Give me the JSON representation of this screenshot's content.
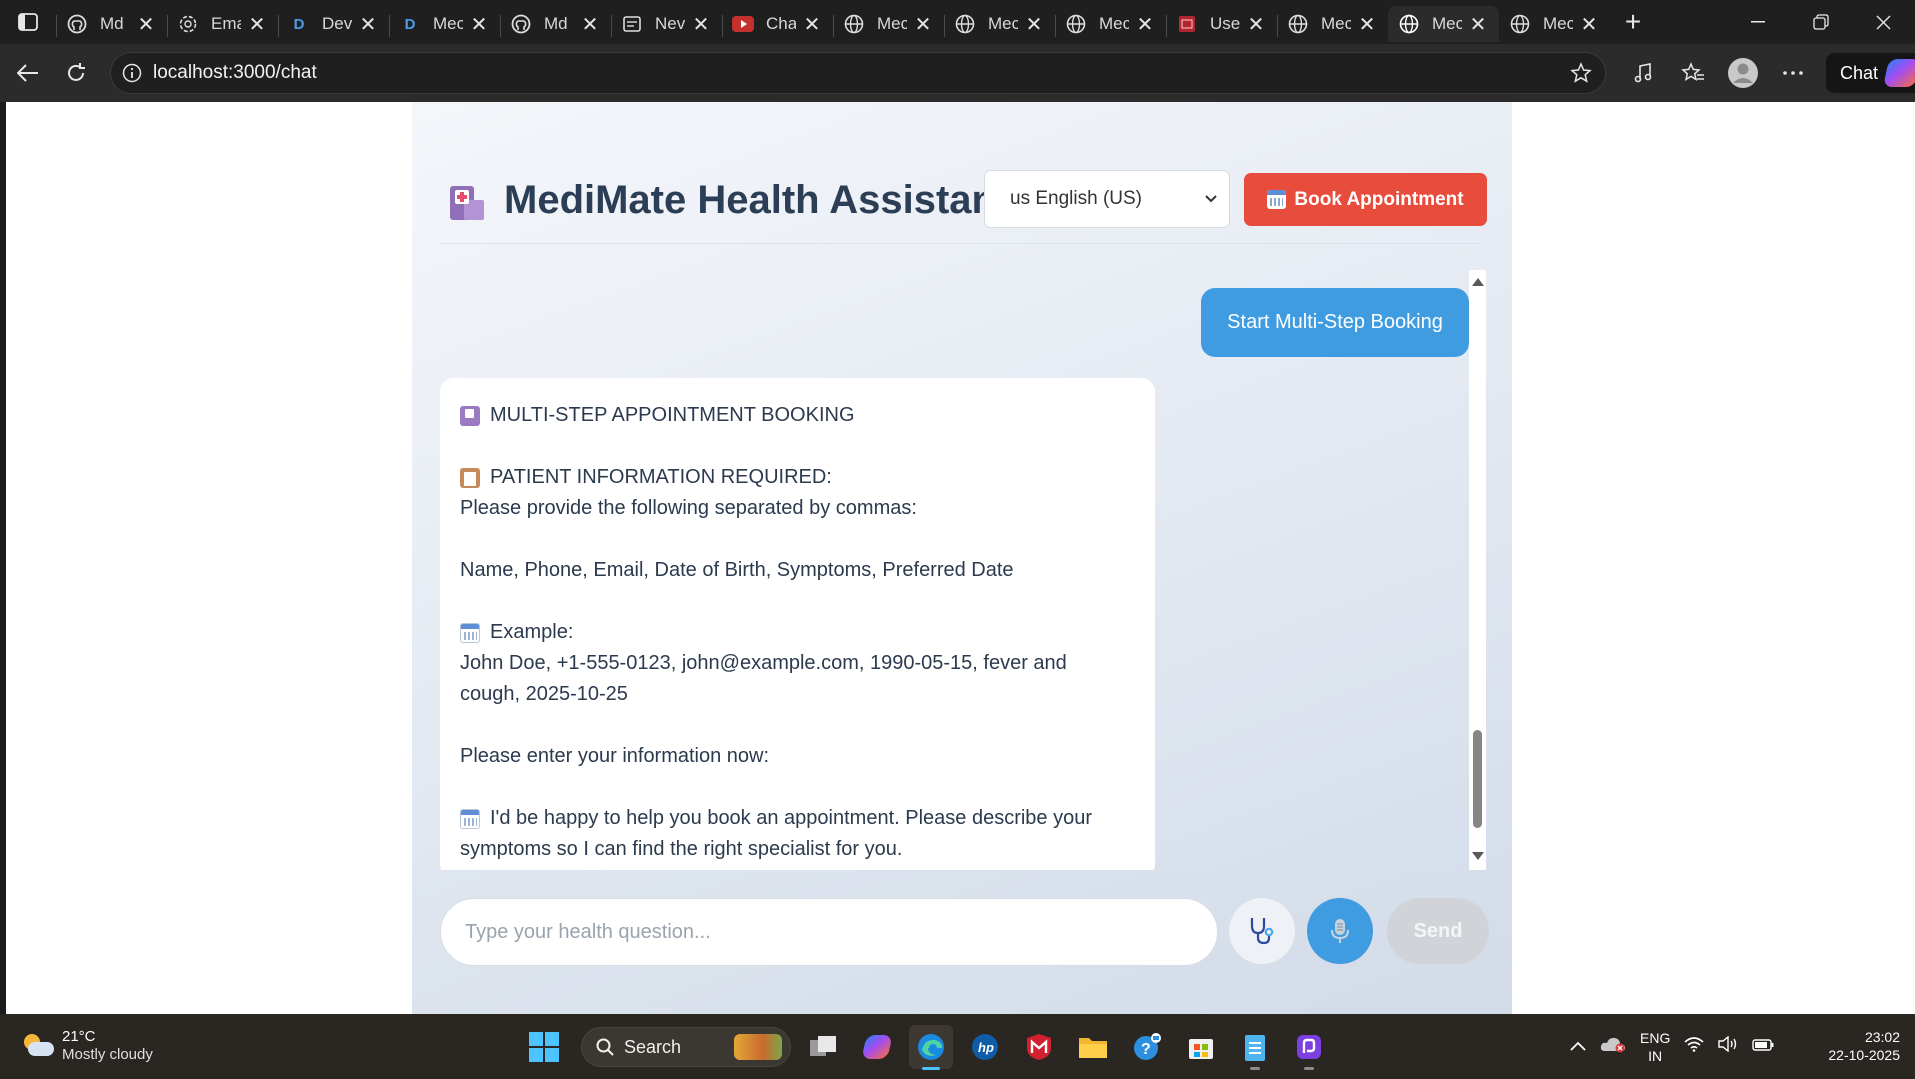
{
  "browser": {
    "tabs": [
      {
        "title": "Md",
        "icon": "github-icon"
      },
      {
        "title": "Ema",
        "icon": "openai-icon"
      },
      {
        "title": "Dev",
        "icon": "d-icon"
      },
      {
        "title": "Mec",
        "icon": "d-icon"
      },
      {
        "title": "Md",
        "icon": "github-icon"
      },
      {
        "title": "Nev",
        "icon": "page-icon"
      },
      {
        "title": "Cha",
        "icon": "youtube-icon"
      },
      {
        "title": "Mec",
        "icon": "globe-icon"
      },
      {
        "title": "Mec",
        "icon": "globe-icon"
      },
      {
        "title": "Mec",
        "icon": "globe-icon"
      },
      {
        "title": "Use",
        "icon": "pdf-icon"
      },
      {
        "title": "Mec",
        "icon": "globe-icon"
      },
      {
        "title": "Mec",
        "icon": "globe-icon"
      },
      {
        "title": "Mec",
        "icon": "globe-icon"
      }
    ],
    "active_tab_index": 12,
    "url": "localhost:3000/chat",
    "chat_button": "Chat"
  },
  "app": {
    "title": "MediMate Health Assistant",
    "language_selected": "us English (US)",
    "book_button": "Book Appointment"
  },
  "chat": {
    "user_message": "Start Multi-Step Booking",
    "bot_lines": {
      "heading": "MULTI-STEP APPOINTMENT BOOKING",
      "patient_info": "PATIENT INFORMATION REQUIRED:",
      "instruction": "Please provide the following separated by commas:",
      "fields": "Name, Phone, Email, Date of Birth, Symptoms, Preferred Date",
      "example_label": "Example:",
      "example_1": "John Doe, +1-555-0123, john@example.com, 1990-05-15, fever and",
      "example_2": "cough, 2025-10-25",
      "enter_now": "Please enter your information now:",
      "followup_1": "I'd be happy to help you book an appointment. Please describe your",
      "followup_2": "symptoms so I can find the right specialist for you."
    }
  },
  "input": {
    "placeholder": "Type your health question...",
    "send_label": "Send"
  },
  "taskbar": {
    "temperature": "21°C",
    "weather": "Mostly cloudy",
    "search_label": "Search",
    "lang_1": "ENG",
    "lang_2": "IN",
    "time": "23:02",
    "date": "22-10-2025"
  },
  "colors": {
    "book_button": "#e74c3c",
    "user_bubble": "#3f9ce0",
    "mic_button": "#3f9ce0",
    "title_text": "#2c3e55"
  }
}
